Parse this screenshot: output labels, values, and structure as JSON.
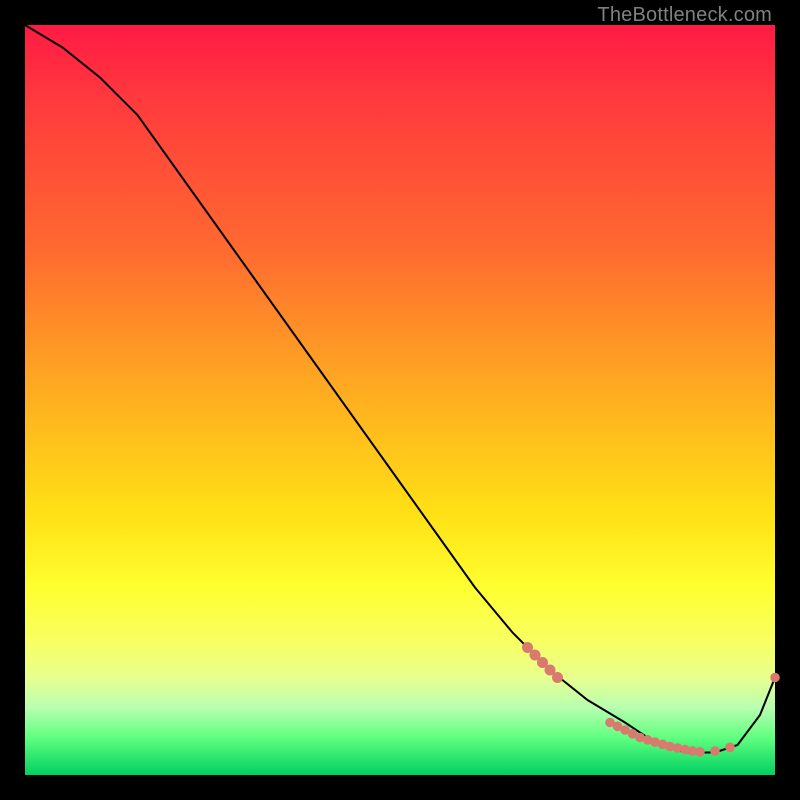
{
  "watermark": "TheBottleneck.com",
  "accent_colors": {
    "marker": "#d87a6e",
    "line": "#000000"
  },
  "chart_data": {
    "type": "line",
    "title": "",
    "xlabel": "",
    "ylabel": "",
    "xlim": [
      0,
      100
    ],
    "ylim": [
      0,
      100
    ],
    "series": [
      {
        "name": "bottleneck-curve",
        "x": [
          0,
          5,
          10,
          15,
          20,
          25,
          30,
          35,
          40,
          45,
          50,
          55,
          60,
          65,
          70,
          75,
          80,
          83,
          85,
          88,
          90,
          92,
          95,
          98,
          100
        ],
        "y": [
          100,
          97,
          93,
          88,
          81,
          74,
          67,
          60,
          53,
          46,
          39,
          32,
          25,
          19,
          14,
          10,
          7,
          5,
          4,
          3,
          3,
          3,
          4,
          8,
          13
        ]
      }
    ],
    "markers": {
      "name": "highlight-points",
      "x": [
        67,
        68,
        69,
        70,
        71,
        78,
        79,
        80,
        81,
        82,
        83,
        84,
        85,
        86,
        87,
        88,
        89,
        90,
        92,
        94,
        100
      ],
      "y": [
        17,
        16,
        15,
        14,
        13,
        7,
        6.5,
        6,
        5.5,
        5,
        4.7,
        4.4,
        4.1,
        3.8,
        3.6,
        3.4,
        3.2,
        3.1,
        3.2,
        3.7,
        13
      ]
    }
  }
}
